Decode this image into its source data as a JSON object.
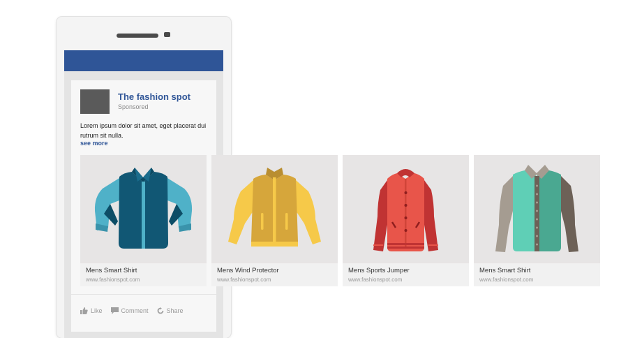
{
  "post": {
    "page_name": "The fashion spot",
    "sponsored_label": "Sponsored",
    "body": "Lorem ipsum dolor sit amet, eget placerat dui rutrum sit nulla.",
    "see_more": "see more"
  },
  "carousel": [
    {
      "title": "Mens Smart Shirt",
      "url": "www.fashionspot.com",
      "image": "teal-vest-jacket-icon"
    },
    {
      "title": "Mens Wind Protector",
      "url": "www.fashionspot.com",
      "image": "yellow-wind-jacket-icon"
    },
    {
      "title": "Mens Sports Jumper",
      "url": "www.fashionspot.com",
      "image": "red-varsity-jacket-icon"
    },
    {
      "title": "Mens Smart Shirt",
      "url": "www.fashionspot.com",
      "image": "mint-shirt-jacket-icon"
    }
  ],
  "actions": {
    "like": "Like",
    "comment": "Comment",
    "share": "Share"
  },
  "colors": {
    "facebook_blue": "#2f5597",
    "avatar": "#5a5a5a"
  }
}
